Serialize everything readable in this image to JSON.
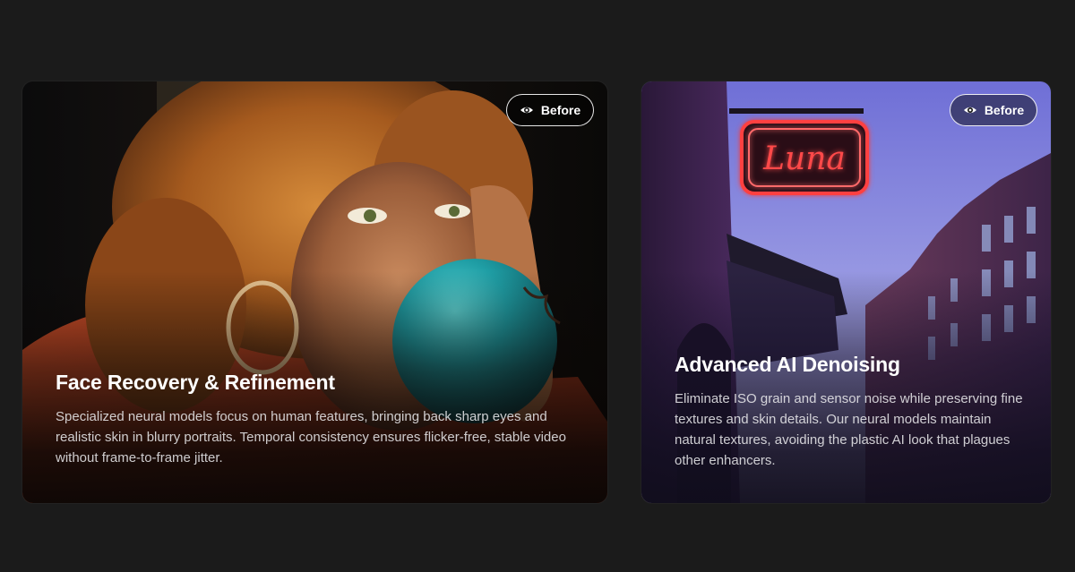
{
  "cards": [
    {
      "button_label": "Before",
      "button_icon": "eye-icon",
      "title": "Face Recovery & Refinement",
      "description": "Specialized neural models focus on human features, bringing back sharp eyes and realistic skin in blurry portraits. Temporal consistency ensures flicker-free, stable video without frame-to-frame jitter."
    },
    {
      "button_label": "Before",
      "button_icon": "eye-icon",
      "title": "Advanced AI Denoising",
      "description": "Eliminate ISO grain and sensor noise while preserving fine textures and skin details. Our neural models maintain natural textures, avoiding the plastic AI look that plagues other enhancers.",
      "sign_text": "Luna"
    }
  ],
  "colors": {
    "page_background": "#1b1b1b",
    "text_primary": "#ffffff",
    "text_secondary": "#dcdce0",
    "neon_red": "#ff3b3b",
    "balloon_teal": "#1fa0a6"
  }
}
